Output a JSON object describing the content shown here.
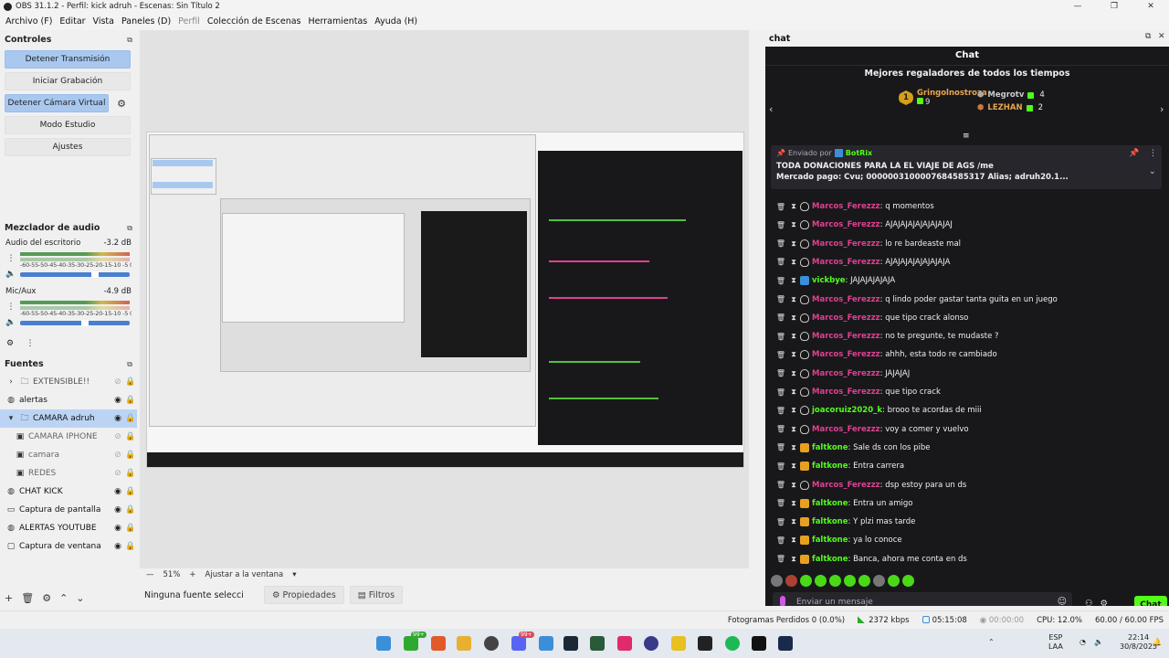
{
  "window": {
    "title": "OBS 31.1.2 - Perfil: kick adruh - Escenas: Sin Título 2",
    "controls": [
      "—",
      "❐",
      "✕"
    ]
  },
  "menu": {
    "items": [
      "Archivo (F)",
      "Editar",
      "Vista",
      "Paneles (D)",
      "Perfil",
      "Colección de Escenas",
      "Herramientas",
      "Ayuda (H)"
    ]
  },
  "controls": {
    "title": "Controles",
    "stop_stream": "Detener Transmisión",
    "start_recording": "Iniciar Grabación",
    "stop_virtual_cam": "Detener Cámara Virtual",
    "studio_mode": "Modo Estudio",
    "settings": "Ajustes"
  },
  "mixer": {
    "title": "Mezclador de audio",
    "channels": [
      {
        "name": "Audio del escritorio",
        "level": "-3.2 dB",
        "volume": 0.7
      },
      {
        "name": "Mic/Aux",
        "level": "-4.9 dB",
        "volume": 0.6
      }
    ],
    "scale": "-60-55-50-45-40-35-30-25-20-15-10 -5  0"
  },
  "sources": {
    "title": "Fuentes",
    "items": [
      {
        "name": "EXTENSIBLE!!",
        "icon": "folder-icon"
      },
      {
        "name": "alertas",
        "icon": "globe-icon"
      },
      {
        "name": "CAMARA adruh",
        "icon": "folder-icon"
      },
      {
        "name": "CAMARA IPHONE",
        "icon": "camera-icon"
      },
      {
        "name": "camara",
        "icon": "camera-icon"
      },
      {
        "name": "REDES",
        "icon": "camera-icon"
      },
      {
        "name": "CHAT KICK",
        "icon": "globe-icon"
      },
      {
        "name": "Captura de pantalla",
        "icon": "monitor-icon"
      },
      {
        "name": "ALERTAS YOUTUBE",
        "icon": "globe-icon"
      },
      {
        "name": "Captura de ventana",
        "icon": "window-icon"
      }
    ]
  },
  "preview": {
    "zoom": "51%",
    "fit_label": "Ajustar a la ventana"
  },
  "source_toolbar": {
    "no_source": "Ninguna fuente seleccionada",
    "properties": "Propiedades",
    "filters": "Filtros"
  },
  "chat": {
    "dock_title": "chat",
    "title": "Chat",
    "top_gifters_title": "Mejores regaladores de todos los tiempos",
    "gifters": [
      {
        "rank": "1",
        "name": "Gringolnostroza",
        "count": "9"
      },
      {
        "name": "Megrotv",
        "count": "4"
      },
      {
        "name": "LEZHAN",
        "count": "2"
      }
    ],
    "pinned": {
      "sent_by_label": "Enviado por",
      "sender": "BotRix",
      "line1": "TODA DONACIONES PARA LA EL VIAJE DE AGS /me",
      "line2": "Mercado pago: Cvu; 0000003100007684585317 Alias; adruh20.1..."
    },
    "messages": [
      {
        "user": "Marcos_Ferezzz",
        "text": "q momentos",
        "color": "#e04090",
        "badge": "shield"
      },
      {
        "user": "Marcos_Ferezzz",
        "text": "AJAJAJAJAJAJAJAJAJ",
        "color": "#e04090",
        "badge": "shield"
      },
      {
        "user": "Marcos_Ferezzz",
        "text": "lo re bardeaste mal",
        "color": "#e04090",
        "badge": "shield"
      },
      {
        "user": "Marcos_Ferezzz",
        "text": "AJAJAJAJAJAJAJAJA",
        "color": "#e04090",
        "badge": "shield"
      },
      {
        "user": "vickbye",
        "text": "JAJAJAJAJAJA",
        "color": "#53fc18",
        "badge": "kick"
      },
      {
        "user": "Marcos_Ferezzz",
        "text": "q lindo poder gastar tanta guita en un juego",
        "color": "#e04090",
        "badge": "shield"
      },
      {
        "user": "Marcos_Ferezzz",
        "text": "que tipo crack alonso",
        "color": "#e04090",
        "badge": "shield"
      },
      {
        "user": "Marcos_Ferezzz",
        "text": "no te pregunte, te mudaste ?",
        "color": "#e04090",
        "badge": "shield"
      },
      {
        "user": "Marcos_Ferezzz",
        "text": "ahhh, esta todo re cambiado",
        "color": "#e04090",
        "badge": "shield"
      },
      {
        "user": "Marcos_Ferezzz",
        "text": "JAJAJAJ",
        "color": "#e04090",
        "badge": "shield"
      },
      {
        "user": "Marcos_Ferezzz",
        "text": "que tipo crack",
        "color": "#e04090",
        "badge": "shield"
      },
      {
        "user": "joacoruiz2020_k",
        "text": "brooo te acordas de miii",
        "color": "#53fc18",
        "badge": "shield"
      },
      {
        "user": "Marcos_Ferezzz",
        "text": "voy a comer y vuelvo",
        "color": "#e04090",
        "badge": "shield"
      },
      {
        "user": "faltkone",
        "text": "Sale ds con los pibe",
        "color": "#53fc18",
        "badge": "crown"
      },
      {
        "user": "faltkone",
        "text": "Entra carrera",
        "color": "#53fc18",
        "badge": "crown"
      },
      {
        "user": "Marcos_Ferezzz",
        "text": "dsp estoy para un ds",
        "color": "#e04090",
        "badge": "shield"
      },
      {
        "user": "faltkone",
        "text": "Entra un amigo",
        "color": "#53fc18",
        "badge": "crown"
      },
      {
        "user": "faltkone",
        "text": "Y plzi mas tarde",
        "color": "#53fc18",
        "badge": "crown"
      },
      {
        "user": "faltkone",
        "text": "ya lo conoce",
        "color": "#53fc18",
        "badge": "crown"
      },
      {
        "user": "faltkone",
        "text": "Banca, ahora me conta en ds",
        "color": "#53fc18",
        "badge": "crown"
      }
    ],
    "input_placeholder": "Enviar un mensaje",
    "send_label": "Chat"
  },
  "status": {
    "dropped_frames": "Fotogramas Perdidos 0 (0.0%)",
    "bitrate": "2372 kbps",
    "stream_time": "05:15:08",
    "rec_time": "00:00:00",
    "cpu": "CPU: 12.0%",
    "fps": "60.00 / 60.00 FPS"
  },
  "taskbar": {
    "badge1": "99+",
    "badge2": "99+",
    "lang1": "ESP",
    "lang2": "LAA",
    "time": "22:14",
    "date": "30/8/2025"
  },
  "colors": {
    "kick_green": "#53fc18",
    "chat_bg": "#18181b",
    "active_button": "#a8c8f0"
  }
}
